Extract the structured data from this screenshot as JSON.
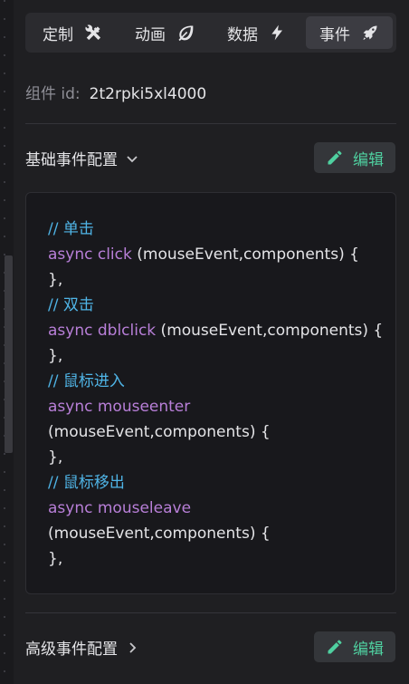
{
  "tabs": [
    {
      "label": "定制",
      "icon": "tools-icon",
      "active": false
    },
    {
      "label": "动画",
      "icon": "leaf-icon",
      "active": false
    },
    {
      "label": "数据",
      "icon": "lightning-icon",
      "active": false
    },
    {
      "label": "事件",
      "icon": "rocket-icon",
      "active": true
    }
  ],
  "component": {
    "id_label": "组件 id:",
    "id_value": "2t2rpki5xl4000"
  },
  "basic_events": {
    "title": "基础事件配置",
    "edit_label": "编辑",
    "code": [
      {
        "type": "comment",
        "text": "// 单击"
      },
      {
        "type": "mixed",
        "keyword": "async click",
        "rest": " (mouseEvent,components) {"
      },
      {
        "type": "plain",
        "text": "},"
      },
      {
        "type": "comment",
        "text": "// 双击"
      },
      {
        "type": "mixed",
        "keyword": "async dblclick",
        "rest": " (mouseEvent,components) {"
      },
      {
        "type": "plain",
        "text": "},"
      },
      {
        "type": "comment",
        "text": "// 鼠标进入"
      },
      {
        "type": "mixed",
        "keyword": "async mouseenter",
        "rest": ""
      },
      {
        "type": "plain",
        "text": "(mouseEvent,components) {"
      },
      {
        "type": "plain",
        "text": "},"
      },
      {
        "type": "comment",
        "text": "// 鼠标移出"
      },
      {
        "type": "mixed",
        "keyword": "async mouseleave",
        "rest": ""
      },
      {
        "type": "plain",
        "text": "(mouseEvent,components) {"
      },
      {
        "type": "plain",
        "text": "},"
      }
    ]
  },
  "advanced_events": {
    "title": "高级事件配置",
    "edit_label": "编辑"
  },
  "colors": {
    "accent": "#4fd0a0",
    "comment": "#4fb4e6",
    "keyword": "#b87fd8"
  }
}
